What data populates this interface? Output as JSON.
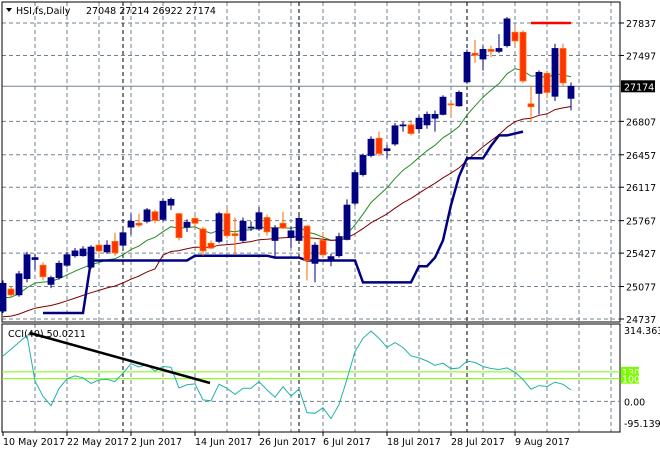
{
  "chart_data": {
    "type": "candlestick",
    "title": "HSI,fs,Daily",
    "header_values": [
      "27048",
      "27214",
      "26922",
      "27174"
    ],
    "current_price": 27174,
    "current_price_label": "27174",
    "ylim": [
      24737,
      27837
    ],
    "y_ticks": [
      27837,
      27497,
      26807,
      26457,
      26117,
      25767,
      25427,
      25077,
      24737
    ],
    "y_tick_labels": [
      "27837",
      "27497",
      "26807",
      "26457",
      "26117",
      "25767",
      "25427",
      "25077",
      "24737"
    ],
    "x_tick_labels": [
      "10 May 2017",
      "22 May 2017",
      "2 Jun 2017",
      "14 Jun 2017",
      "26 Jun 2017",
      "6 Jul 2017",
      "18 Jul 2017",
      "28 Jul 2017",
      "9 Aug 2017"
    ],
    "resistance_level": 27837,
    "colors": {
      "bull": "#000080",
      "bear": "#ff3300",
      "bear_border": "#ff6a00",
      "ma_fast": "#228b22",
      "ma_slow": "#800000",
      "lower_band": "#000080",
      "cci": "#20b2aa",
      "levels": "#7cfc00"
    },
    "ohlc": [
      [
        24820,
        25140,
        24800,
        25110
      ],
      [
        25050,
        25080,
        24960,
        24990
      ],
      [
        24990,
        25240,
        24970,
        25210
      ],
      [
        25160,
        25440,
        25120,
        25410
      ],
      [
        25360,
        25420,
        25250,
        25380
      ],
      [
        25300,
        25330,
        25140,
        25180
      ],
      [
        25100,
        25190,
        25060,
        25170
      ],
      [
        25170,
        25350,
        25150,
        25320
      ],
      [
        25300,
        25440,
        25280,
        25410
      ],
      [
        25400,
        25480,
        25380,
        25450
      ],
      [
        25400,
        25500,
        25390,
        25470
      ],
      [
        25280,
        25510,
        25260,
        25490
      ],
      [
        25510,
        25540,
        25420,
        25450
      ],
      [
        25440,
        25560,
        25420,
        25510
      ],
      [
        25550,
        25640,
        25400,
        25430
      ],
      [
        25510,
        25670,
        25480,
        25640
      ],
      [
        25700,
        25840,
        25620,
        25760
      ],
      [
        25740,
        25840,
        25700,
        25720
      ],
      [
        25760,
        25900,
        25740,
        25880
      ],
      [
        25860,
        25880,
        25740,
        25770
      ],
      [
        25780,
        26000,
        25760,
        25970
      ],
      [
        25930,
        26010,
        25880,
        25990
      ],
      [
        25840,
        25850,
        25560,
        25590
      ],
      [
        25700,
        25780,
        25650,
        25750
      ],
      [
        25790,
        25820,
        25700,
        25740
      ],
      [
        25680,
        25700,
        25400,
        25450
      ],
      [
        25530,
        25560,
        25470,
        25480
      ],
      [
        25550,
        25860,
        25530,
        25840
      ],
      [
        25840,
        25890,
        25580,
        25610
      ],
      [
        25630,
        25800,
        25420,
        25610
      ],
      [
        25560,
        25800,
        25540,
        25760
      ],
      [
        25700,
        25760,
        25660,
        25700
      ],
      [
        25680,
        25910,
        25660,
        25850
      ],
      [
        25800,
        25830,
        25610,
        25650
      ],
      [
        25560,
        25720,
        25380,
        25690
      ],
      [
        25740,
        25860,
        25680,
        25690
      ],
      [
        25590,
        25710,
        25480,
        25660
      ],
      [
        25560,
        25820,
        25540,
        25790
      ],
      [
        25710,
        25720,
        25140,
        25350
      ],
      [
        25320,
        25540,
        25120,
        25510
      ],
      [
        25560,
        25650,
        25380,
        25410
      ],
      [
        25360,
        25420,
        25290,
        25390
      ],
      [
        25400,
        25640,
        25380,
        25600
      ],
      [
        25570,
        25990,
        25560,
        25930
      ],
      [
        25950,
        26300,
        25930,
        26270
      ],
      [
        26250,
        26470,
        26230,
        26450
      ],
      [
        26450,
        26650,
        26430,
        26620
      ],
      [
        26630,
        26700,
        26440,
        26470
      ],
      [
        26500,
        26560,
        26420,
        26520
      ],
      [
        26570,
        26790,
        26550,
        26760
      ],
      [
        26760,
        26800,
        26700,
        26770
      ],
      [
        26770,
        26820,
        26660,
        26680
      ],
      [
        26730,
        26870,
        26680,
        26840
      ],
      [
        26770,
        26910,
        26730,
        26880
      ],
      [
        26840,
        26920,
        26700,
        26880
      ],
      [
        26880,
        27080,
        26870,
        27060
      ],
      [
        26990,
        27000,
        26850,
        26980
      ],
      [
        26970,
        27130,
        26960,
        27110
      ],
      [
        27220,
        27560,
        27200,
        27530
      ],
      [
        27520,
        27660,
        27420,
        27500
      ],
      [
        27460,
        27600,
        27340,
        27560
      ],
      [
        27560,
        27600,
        27480,
        27540
      ],
      [
        27540,
        27720,
        27520,
        27570
      ],
      [
        27600,
        27900,
        27580,
        27880
      ],
      [
        27740,
        27800,
        27600,
        27650
      ],
      [
        27740,
        27760,
        27210,
        27230
      ],
      [
        26990,
        27180,
        26800,
        26960
      ],
      [
        27100,
        27340,
        26880,
        27320
      ],
      [
        27310,
        27340,
        27050,
        27110
      ],
      [
        27070,
        27620,
        27020,
        27570
      ],
      [
        27570,
        27620,
        27180,
        27210
      ],
      [
        27048,
        27214,
        26922,
        27174
      ]
    ],
    "cci": {
      "label": "CCI(40) 50.0211",
      "period": 40,
      "last_value": 50.0211,
      "ylim": [
        -95.1391,
        314.3633
      ],
      "y_tick_labels": [
        "314.3633",
        "0.00",
        "-95.1391"
      ],
      "levels": [
        130,
        100
      ],
      "level_labels": [
        "130",
        "100"
      ]
    }
  }
}
